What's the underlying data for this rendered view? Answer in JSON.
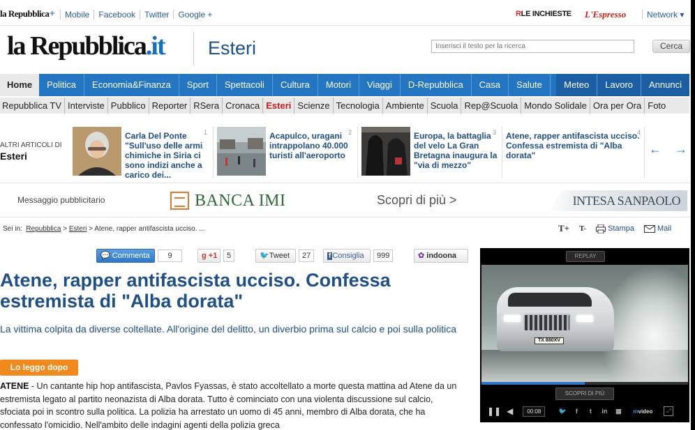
{
  "topbar": {
    "logo_main": "la Repubblica",
    "logo_plus": "+",
    "links": [
      "Mobile",
      "Facebook",
      "Twitter",
      "Google +"
    ],
    "r_letter": "R",
    "inchieste_label": "LE INCHIESTE",
    "espresso_label": "L'Espresso",
    "network_label": "Network ▾"
  },
  "header": {
    "logo_main": "la Repubblica",
    "logo_it": ".it",
    "section": "Esteri",
    "search_placeholder": "Inserisci il testo per la ricerca",
    "search_button": "Cerca"
  },
  "mainnav": {
    "left": [
      "Home",
      "Politica",
      "Economia&Finanza",
      "Sport",
      "Spettacoli",
      "Cultura",
      "Motori",
      "Viaggi",
      "D-Repubblica",
      "Casa",
      "Salute"
    ],
    "right": [
      "Meteo",
      "Lavoro",
      "Annunci"
    ]
  },
  "subnav": [
    "Repubblica TV",
    "Interviste",
    "Pubblico",
    "Reporter",
    "RSera",
    "Cronaca",
    "Esteri",
    "Scienze",
    "Tecnologia",
    "Ambiente",
    "Scuola",
    "Rep@Scuola",
    "Mondo Solidale",
    "Ora per Ora",
    "Foto"
  ],
  "others": {
    "label": "ALTRI ARTICOLI DI",
    "section": "Esteri",
    "items": [
      {
        "num": "1",
        "text": "Carla Del Ponte \"Sull'uso delle armi chimiche in Siria ci sono indizi anche a carico dei..."
      },
      {
        "num": "2",
        "text": "Acapulco, uragani intrappolano 40.000 turisti all'aeroporto"
      },
      {
        "num": "3",
        "text": "Europa, la battaglia del velo La Gran Bretagna inaugura la \"via di mezzo\""
      },
      {
        "num": "4",
        "text": "Atene, rapper antifascista ucciso. Confessa estremista di \"Alba dorata\""
      }
    ],
    "prev_arrow": "←",
    "next_arrow": "→"
  },
  "ad": {
    "message": "Messaggio pubblicitario",
    "banca": "BANCA IMI",
    "scopri": "Scopri di più  >",
    "intesa": "INTESA SANPAOLO"
  },
  "crumbs": {
    "prefix": "Sei in:",
    "repubblica": "Repubblica",
    "sep1": ">",
    "esteri": "Esteri",
    "rest": "> Atene, rapper antifascista ucciso. ...",
    "text_bigger": "T+",
    "text_smaller": "T-",
    "stampa": "Stampa",
    "mail": "Mail"
  },
  "social": {
    "commenta_label": "Commenta",
    "commenta_count": "9",
    "gplus_label": "+1",
    "gplus_count": "5",
    "tweet_label": "Tweet",
    "tweet_count": "27",
    "fb_label": "Consiglia",
    "fb_count": "999",
    "indoona_label": "indoona"
  },
  "article": {
    "headline": "Atene, rapper antifascista ucciso. Confessa estremista di \"Alba dorata\"",
    "subhead": "La vittima colpita da diverse coltellate. All'origine del delitto, un diverbio prima sul calcio e poi sulla politica",
    "read_later": "Lo leggo dopo",
    "lead_word": "ATENE",
    "body": " - Un cantante hip hop antifascista, Pavlos Fyassas, è stato accoltellato a morte questa mattina ad Atene da un estremista legato al partito neonazista di Alba dorata. Tutto è cominciato con una violenta discussione sul calcio, sfociata poi in scontro sulla politica. La polizia ha arrestato un uomo di 45 anni, membro di Alba dorata, che ha confessato l'omicidio. Nell'ambito delle indagini agenti della polizia greca"
  },
  "video": {
    "replay": "REPLAY",
    "plate": "TX 880XV",
    "scopri": "SCOPRI DI PIÙ",
    "time": "00:08",
    "progress": 0.5,
    "brand_m": "m",
    "brand_video": "video"
  }
}
